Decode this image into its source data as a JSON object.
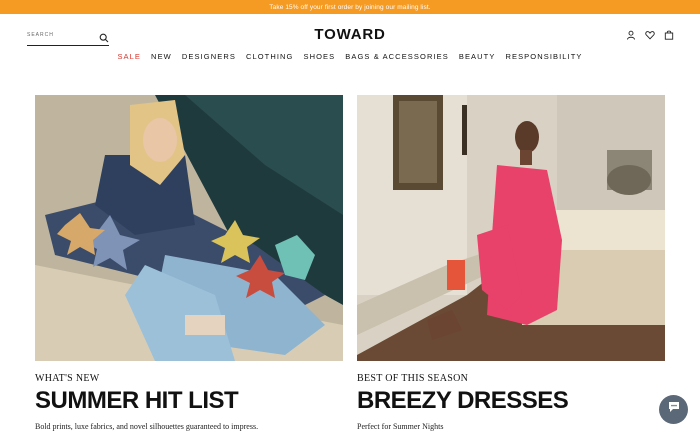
{
  "promo": {
    "text": "Take 15% off your first order by joining our mailing list."
  },
  "header": {
    "search_label": "SEARCH",
    "logo": "TOWARD",
    "icons": [
      "search-icon",
      "account-icon",
      "heart-icon",
      "bag-icon"
    ]
  },
  "nav": [
    {
      "label": "SALE",
      "color": "#d9342b"
    },
    {
      "label": "NEW"
    },
    {
      "label": "DESIGNERS"
    },
    {
      "label": "CLOTHING"
    },
    {
      "label": "SHOES"
    },
    {
      "label": "BAGS & ACCESSORIES"
    },
    {
      "label": "BEAUTY"
    },
    {
      "label": "RESPONSIBILITY"
    }
  ],
  "features": [
    {
      "eyebrow": "WHAT'S NEW",
      "headline": "SUMMER HIT LIST",
      "subtext": "Bold prints, luxe fabrics, and novel silhouettes guaranteed to impress."
    },
    {
      "eyebrow": "BEST OF THIS SEASON",
      "headline": "BREEZY DRESSES",
      "subtext": "Perfect for Summer Nights"
    }
  ],
  "colors": {
    "promo_bar": "#f59a23",
    "sale": "#d9342b",
    "chat_button": "#5b6877"
  },
  "chat": {
    "icon": "chat-icon"
  }
}
